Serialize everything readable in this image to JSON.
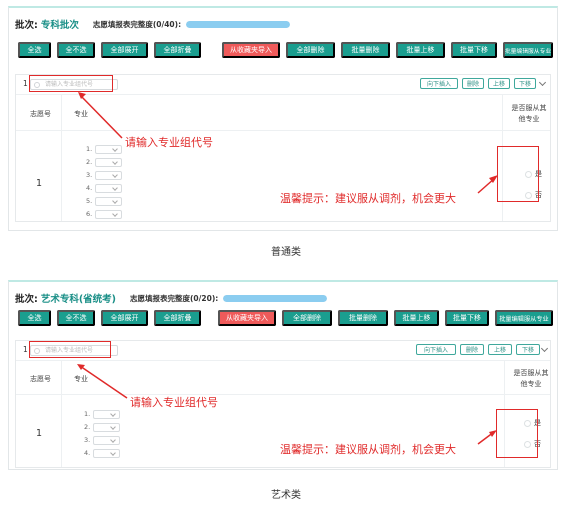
{
  "colors": {
    "accent": "#1a9e8f",
    "danger": "#ef5a5a",
    "annotation": "#e02a2a",
    "progress": "#8bcdf0"
  },
  "toolbar": {
    "buttons": [
      "全选",
      "全不选",
      "全部展开",
      "全部折叠",
      "从收藏夹导入",
      "全部删除",
      "批量删除",
      "批量上移",
      "批量下移",
      "批量编辑服从专业"
    ]
  },
  "mini_buttons": [
    "向下插入",
    "删除",
    "上移",
    "下移"
  ],
  "table": {
    "col_index": "志愿号",
    "col_major": "专业",
    "col_obey": "是否服从其他专业"
  },
  "radio": {
    "yes": "是",
    "no": "否"
  },
  "annotations": {
    "group_code_hint": "请输入专业组代号",
    "tip": "温馨提示：建议服从调剂，机会更大"
  },
  "section1": {
    "batch_label": "批次:",
    "batch_value": "专科批次",
    "progress_label": "志愿填报表完整度(0/40):",
    "progress": 0,
    "group_index": "1",
    "group_placeholder": "请输入专业组代号",
    "row_index": "1",
    "majors": [
      "1.",
      "2.",
      "3.",
      "4.",
      "5.",
      "6."
    ],
    "caption": "普通类"
  },
  "section2": {
    "batch_label": "批次:",
    "batch_value": "艺术专科(省统考)",
    "progress_label": "志愿填报表完整度(0/20):",
    "progress": 0,
    "group_index": "1",
    "group_placeholder": "请输入专业组代号",
    "row_index": "1",
    "majors": [
      "1.",
      "2.",
      "3.",
      "4."
    ],
    "caption": "艺术类"
  }
}
